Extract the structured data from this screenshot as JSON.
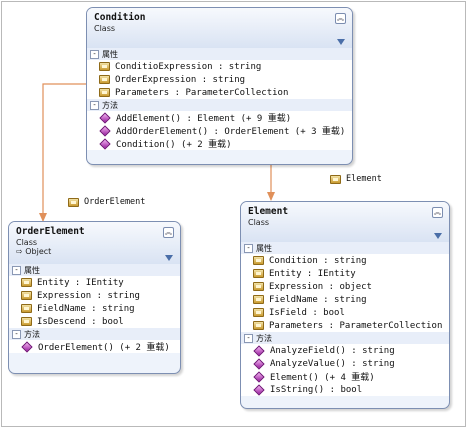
{
  "condition": {
    "title": "Condition",
    "stereotype": "Class",
    "sections": [
      {
        "header": "属性",
        "kind": "property",
        "items": [
          "ConditioExpression : string",
          "OrderExpression : string",
          "Parameters : ParameterCollection"
        ]
      },
      {
        "header": "方法",
        "kind": "method",
        "items": [
          "AddElement() : Element (+ 9 重载)",
          "AddOrderElement() : OrderElement (+ 3 重载)",
          "Condition() (+ 2 重载)"
        ]
      }
    ]
  },
  "orderElement": {
    "title": "OrderElement",
    "stereotype": "Class",
    "base": "Object",
    "sections": [
      {
        "header": "属性",
        "kind": "property",
        "items": [
          "Entity : IEntity",
          "Expression : string",
          "FieldName : string",
          "IsDescend : bool"
        ]
      },
      {
        "header": "方法",
        "kind": "method",
        "items": [
          "OrderElement() (+ 2 重载)"
        ]
      }
    ]
  },
  "element": {
    "title": "Element",
    "stereotype": "Class",
    "sections": [
      {
        "header": "属性",
        "kind": "property",
        "items": [
          "Condition : string",
          "Entity : IEntity",
          "Expression : object",
          "FieldName : string",
          "IsField : bool",
          "Parameters : ParameterCollection"
        ]
      },
      {
        "header": "方法",
        "kind": "method",
        "items": [
          "AnalyzeField() : string",
          "AnalyzeValue() : string",
          "Element() (+ 4 重载)",
          "IsString() : bool"
        ]
      }
    ]
  },
  "associations": {
    "to_order_element": "OrderElement",
    "to_element": "Element"
  },
  "colors": {
    "connector": "#e0905a",
    "border": "#7d8fb2",
    "header": "#d9e3f3"
  }
}
